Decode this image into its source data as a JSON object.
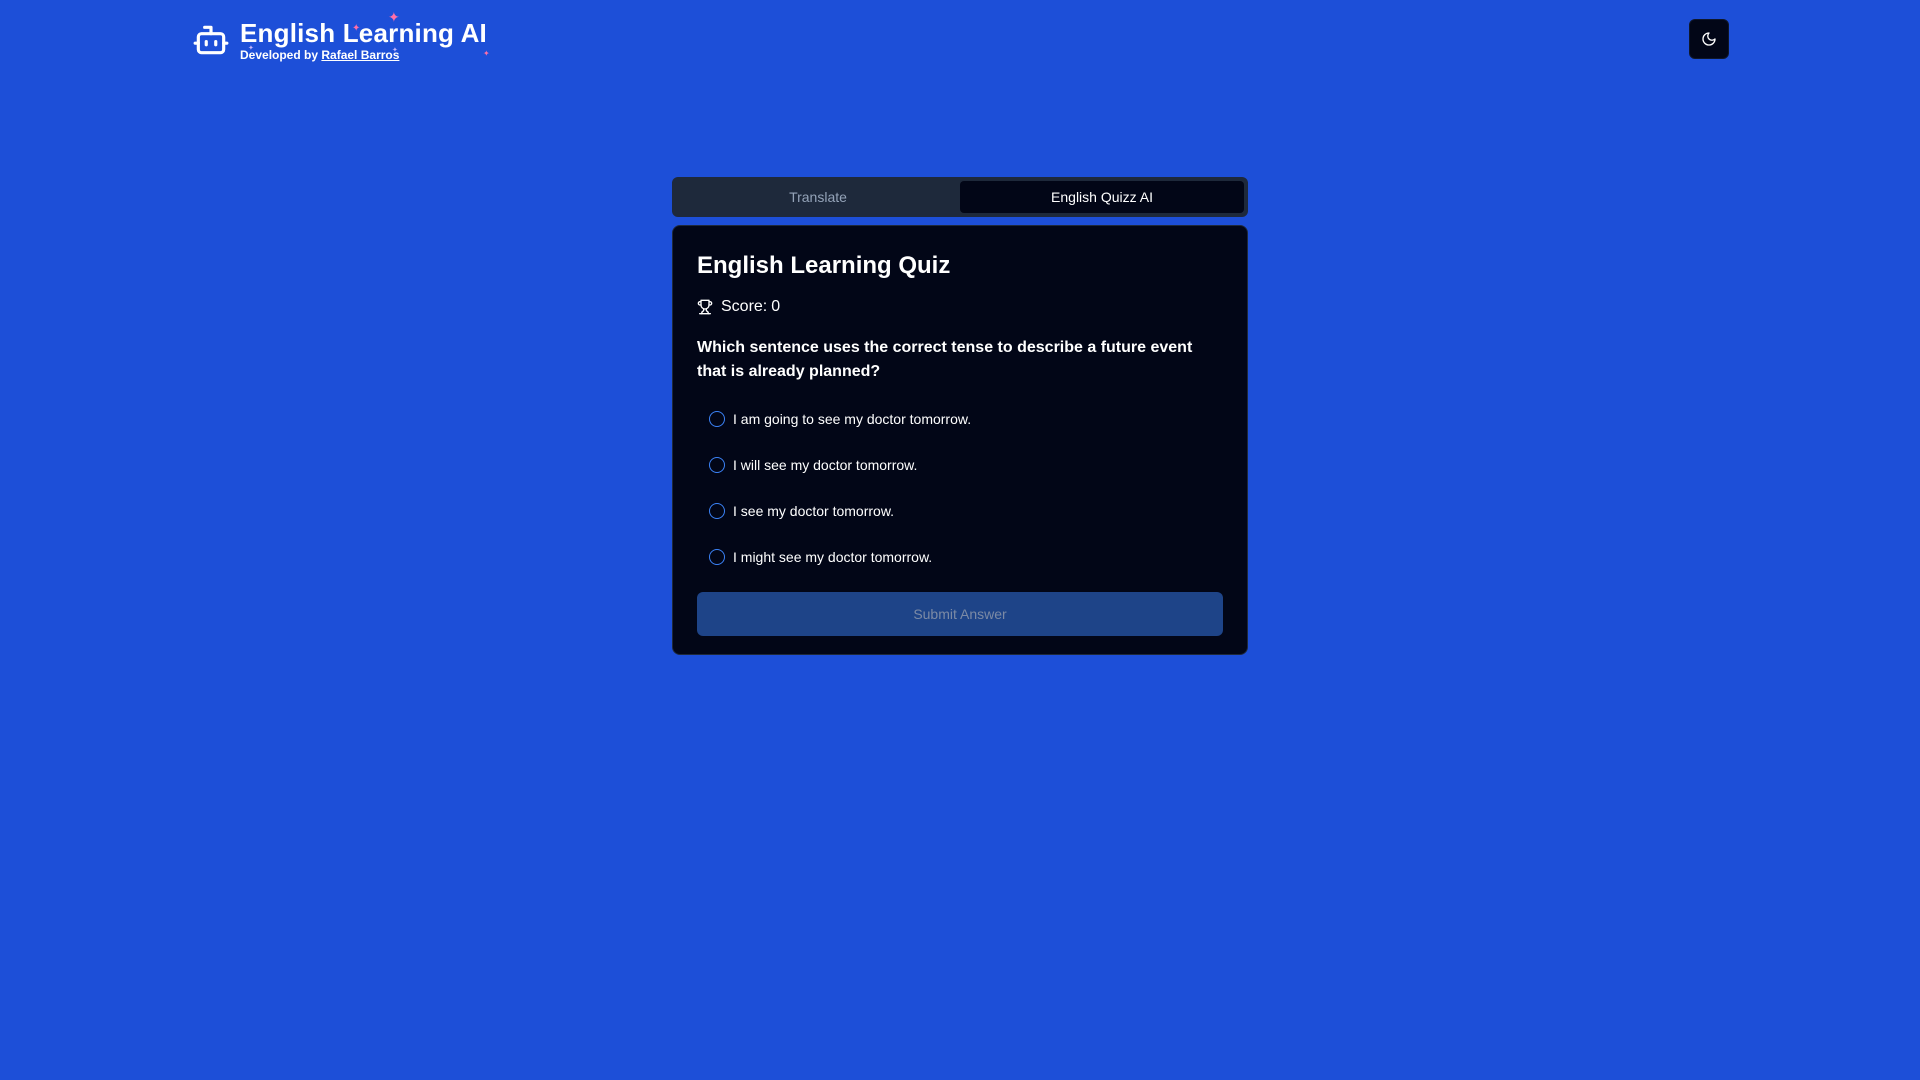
{
  "header": {
    "title": "English Learning AI",
    "subtitle_prefix": "Developed by",
    "author": "Rafael Barros",
    "theme_toggle_icon": "moon-icon",
    "brand_icon": "bot-icon"
  },
  "tabs": [
    {
      "label": "Translate",
      "active": false
    },
    {
      "label": "English Quizz AI",
      "active": true
    }
  ],
  "quiz": {
    "title": "English Learning Quiz",
    "score_icon": "trophy-icon",
    "score_label": "Score:",
    "score_value": "0",
    "question": "Which sentence uses the correct tense to describe a future event that is already planned?",
    "options": [
      "I am going to see my doctor tomorrow.",
      "I will see my doctor tomorrow.",
      "I see my doctor tomorrow.",
      "I might see my doctor tomorrow."
    ],
    "submit_label": "Submit Answer"
  },
  "colors": {
    "background": "#1d4fd8",
    "card": "#020617",
    "tab_bar": "#1e293b",
    "radio_border": "#3b82f6",
    "submit_disabled": "#1e4488",
    "sparkle": "#ff6fa8"
  }
}
